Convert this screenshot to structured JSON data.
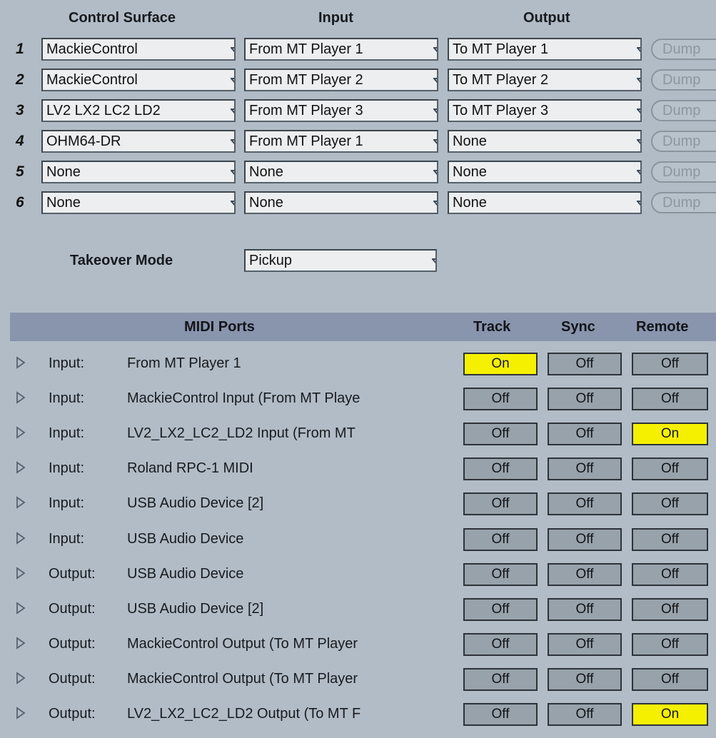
{
  "surfaces": {
    "headers": {
      "control_surface": "Control Surface",
      "input": "Input",
      "output": "Output"
    },
    "rows": [
      {
        "num": "1",
        "surface": "MackieControl",
        "input": "From MT Player 1",
        "output": "To MT Player 1",
        "dump": "Dump"
      },
      {
        "num": "2",
        "surface": "MackieControl",
        "input": "From MT Player 2",
        "output": "To MT Player 2",
        "dump": "Dump"
      },
      {
        "num": "3",
        "surface": "LV2 LX2 LC2 LD2",
        "input": "From MT Player 3",
        "output": "To MT Player 3",
        "dump": "Dump"
      },
      {
        "num": "4",
        "surface": "OHM64-DR",
        "input": "From MT Player 1",
        "output": "None",
        "dump": "Dump"
      },
      {
        "num": "5",
        "surface": "None",
        "input": "None",
        "output": "None",
        "dump": "Dump"
      },
      {
        "num": "6",
        "surface": "None",
        "input": "None",
        "output": "None",
        "dump": "Dump"
      }
    ]
  },
  "takeover": {
    "label": "Takeover Mode",
    "value": "Pickup"
  },
  "midi_ports": {
    "headers": {
      "ports": "MIDI Ports",
      "track": "Track",
      "sync": "Sync",
      "remote": "Remote"
    },
    "rows": [
      {
        "type": "Input:",
        "name": "From MT Player 1",
        "track": "On",
        "sync": "Off",
        "remote": "Off"
      },
      {
        "type": "Input:",
        "name": "MackieControl Input (From MT Playe",
        "track": "Off",
        "sync": "Off",
        "remote": "Off"
      },
      {
        "type": "Input:",
        "name": "LV2_LX2_LC2_LD2 Input (From MT",
        "track": "Off",
        "sync": "Off",
        "remote": "On"
      },
      {
        "type": "Input:",
        "name": "Roland RPC-1 MIDI",
        "track": "Off",
        "sync": "Off",
        "remote": "Off"
      },
      {
        "type": "Input:",
        "name": "USB Audio Device [2]",
        "track": "Off",
        "sync": "Off",
        "remote": "Off"
      },
      {
        "type": "Input:",
        "name": "USB Audio Device",
        "track": "Off",
        "sync": "Off",
        "remote": "Off"
      },
      {
        "type": "Output:",
        "name": "USB Audio Device",
        "track": "Off",
        "sync": "Off",
        "remote": "Off"
      },
      {
        "type": "Output:",
        "name": "USB Audio Device [2]",
        "track": "Off",
        "sync": "Off",
        "remote": "Off"
      },
      {
        "type": "Output:",
        "name": "MackieControl Output (To MT Player",
        "track": "Off",
        "sync": "Off",
        "remote": "Off"
      },
      {
        "type": "Output:",
        "name": "MackieControl Output (To MT Player",
        "track": "Off",
        "sync": "Off",
        "remote": "Off"
      },
      {
        "type": "Output:",
        "name": "LV2_LX2_LC2_LD2 Output (To MT F",
        "track": "Off",
        "sync": "Off",
        "remote": "On"
      }
    ]
  },
  "colors": {
    "on": "#f5f000",
    "off": "#97a2ab",
    "header_bar": "#8994ad",
    "background": "#b2bcc6"
  },
  "icons": {
    "dropdown": "chevron-down-icon",
    "expand": "disclosure-triangle-icon"
  }
}
